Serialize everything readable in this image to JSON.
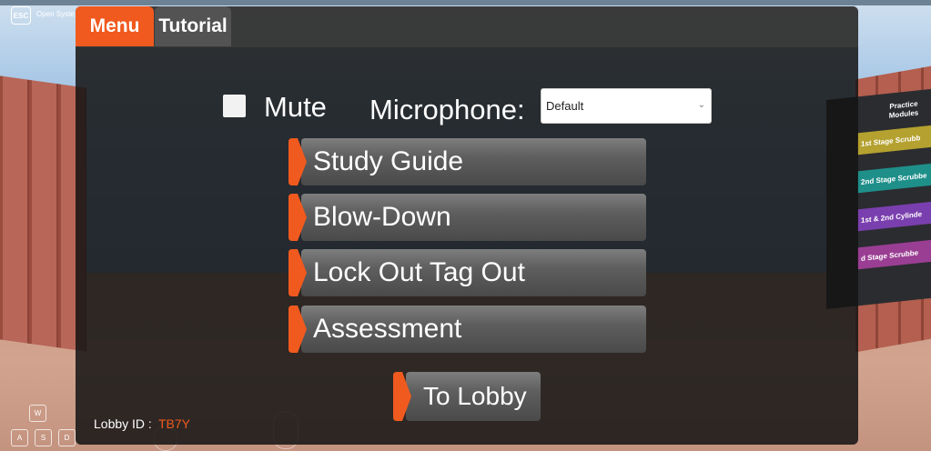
{
  "hud": {
    "esc_key": "ESC",
    "esc_label": "Open Syste",
    "keys": [
      "W",
      "A",
      "S",
      "D"
    ]
  },
  "tabs": [
    {
      "label": "Menu",
      "active": true
    },
    {
      "label": "Tutorial",
      "active": false
    }
  ],
  "audio": {
    "mute_label": "Mute",
    "mute_checked": false,
    "mic_label": "Microphone:",
    "mic_selected": "Default"
  },
  "menu": {
    "items": [
      {
        "label": "Study Guide"
      },
      {
        "label": "Blow-Down"
      },
      {
        "label": "Lock Out Tag Out"
      },
      {
        "label": "Assessment"
      }
    ],
    "lobby_button": "To Lobby"
  },
  "lobby": {
    "id_label": "Lobby ID :",
    "id_value": "TB7Y"
  },
  "practice_sign": {
    "title": "Practice Modules",
    "buttons": [
      {
        "label": "1st Stage Scrubb",
        "color": "#b4a12f"
      },
      {
        "label": "2nd Stage Scrubbe",
        "color": "#1f8f8a"
      },
      {
        "label": "1st & 2nd Cylinde",
        "color": "#7a3fae"
      },
      {
        "label": "d Stage Scrubbe",
        "color": "#9a3e93"
      }
    ]
  },
  "colors": {
    "accent": "#f05a1e",
    "panel": "#141414",
    "button": "#5e5e5e"
  }
}
